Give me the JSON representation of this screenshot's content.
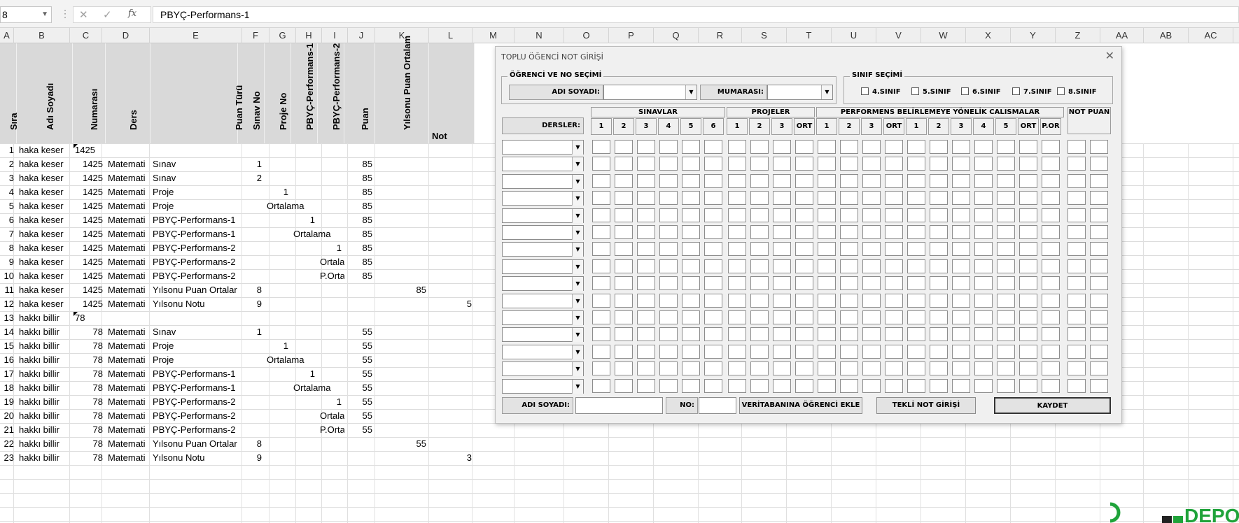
{
  "formula_bar": {
    "name_box": "8",
    "fx": "fx",
    "cancel": "✕",
    "enter": "✓",
    "content": "PBYÇ-Performans-1"
  },
  "columns": [
    "A",
    "B",
    "C",
    "D",
    "E",
    "F",
    "G",
    "H",
    "I",
    "J",
    "K",
    "L",
    "M",
    "N",
    "O",
    "P",
    "Q",
    "R",
    "S",
    "T",
    "U",
    "V",
    "W",
    "X",
    "Y",
    "Z",
    "AA",
    "AB",
    "AC"
  ],
  "header": {
    "sira": "Sıra",
    "adi_soyadi": "Adı Soyadı",
    "numarasi": "Numarası",
    "ders": "Ders",
    "puan_turu": "Puan Türü",
    "sinav_no": "Sınav No",
    "proje_no": "Proje No",
    "pbyc1": "PBYÇ-Performans-1",
    "pbyc2": "PBYÇ-Performans-2",
    "puan": "Puan",
    "yilsonu": "Yılsonu Puan Ortalam",
    "not": "Not"
  },
  "rows": [
    {
      "a": "1",
      "b": "haka keser",
      "c": "1425",
      "d": "",
      "e": "",
      "f": "",
      "g": "",
      "h": "",
      "i": "",
      "j": "",
      "k": "",
      "l": ""
    },
    {
      "a": "2",
      "b": "haka keser",
      "c": "1425",
      "d": "Matemati",
      "e": "Sınav",
      "f": "1",
      "g": "",
      "h": "",
      "i": "",
      "j": "85",
      "k": "",
      "l": ""
    },
    {
      "a": "3",
      "b": "haka keser",
      "c": "1425",
      "d": "Matemati",
      "e": "Sınav",
      "f": "2",
      "g": "",
      "h": "",
      "i": "",
      "j": "85",
      "k": "",
      "l": ""
    },
    {
      "a": "4",
      "b": "haka keser",
      "c": "1425",
      "d": "Matemati",
      "e": "Proje",
      "f": "",
      "g": "1",
      "h": "",
      "i": "",
      "j": "85",
      "k": "",
      "l": ""
    },
    {
      "a": "5",
      "b": "haka keser",
      "c": "1425",
      "d": "Matemati",
      "e": "Proje",
      "f": "",
      "g": "Ortalama",
      "h": "",
      "i": "",
      "j": "85",
      "k": "",
      "l": ""
    },
    {
      "a": "6",
      "b": "haka keser",
      "c": "1425",
      "d": "Matemati",
      "e": "PBYÇ-Performans-1",
      "f": "",
      "g": "",
      "h": "1",
      "i": "",
      "j": "85",
      "k": "",
      "l": ""
    },
    {
      "a": "7",
      "b": "haka keser",
      "c": "1425",
      "d": "Matemati",
      "e": "PBYÇ-Performans-1",
      "f": "",
      "g": "",
      "h": "Ortalama",
      "i": "",
      "j": "85",
      "k": "",
      "l": ""
    },
    {
      "a": "8",
      "b": "haka keser",
      "c": "1425",
      "d": "Matemati",
      "e": "PBYÇ-Performans-2",
      "f": "",
      "g": "",
      "h": "",
      "i": "1",
      "j": "85",
      "k": "",
      "l": ""
    },
    {
      "a": "9",
      "b": "haka keser",
      "c": "1425",
      "d": "Matemati",
      "e": "PBYÇ-Performans-2",
      "f": "",
      "g": "",
      "h": "",
      "i": "Ortala",
      "j": "85",
      "k": "",
      "l": ""
    },
    {
      "a": "10",
      "b": "haka keser",
      "c": "1425",
      "d": "Matemati",
      "e": "PBYÇ-Performans-2",
      "f": "",
      "g": "",
      "h": "",
      "i": "P.Orta",
      "j": "85",
      "k": "",
      "l": ""
    },
    {
      "a": "11",
      "b": "haka keser",
      "c": "1425",
      "d": "Matemati",
      "e": "Yılsonu Puan Ortalar",
      "f": "8",
      "g": "",
      "h": "",
      "i": "",
      "j": "",
      "k": "85",
      "l": ""
    },
    {
      "a": "12",
      "b": "haka keser",
      "c": "1425",
      "d": "Matemati",
      "e": "Yılsonu Notu",
      "f": "9",
      "g": "",
      "h": "",
      "i": "",
      "j": "",
      "k": "",
      "l": "5"
    },
    {
      "a": "13",
      "b": "hakkı billir",
      "c": "78",
      "d": "",
      "e": "",
      "f": "",
      "g": "",
      "h": "",
      "i": "",
      "j": "",
      "k": "",
      "l": ""
    },
    {
      "a": "14",
      "b": "hakkı billir",
      "c": "78",
      "d": "Matemati",
      "e": "Sınav",
      "f": "1",
      "g": "",
      "h": "",
      "i": "",
      "j": "55",
      "k": "",
      "l": ""
    },
    {
      "a": "15",
      "b": "hakkı billir",
      "c": "78",
      "d": "Matemati",
      "e": "Proje",
      "f": "",
      "g": "1",
      "h": "",
      "i": "",
      "j": "55",
      "k": "",
      "l": ""
    },
    {
      "a": "16",
      "b": "hakkı billir",
      "c": "78",
      "d": "Matemati",
      "e": "Proje",
      "f": "",
      "g": "Ortalama",
      "h": "",
      "i": "",
      "j": "55",
      "k": "",
      "l": ""
    },
    {
      "a": "17",
      "b": "hakkı billir",
      "c": "78",
      "d": "Matemati",
      "e": "PBYÇ-Performans-1",
      "f": "",
      "g": "",
      "h": "1",
      "i": "",
      "j": "55",
      "k": "",
      "l": ""
    },
    {
      "a": "18",
      "b": "hakkı billir",
      "c": "78",
      "d": "Matemati",
      "e": "PBYÇ-Performans-1",
      "f": "",
      "g": "",
      "h": "Ortalama",
      "i": "",
      "j": "55",
      "k": "",
      "l": ""
    },
    {
      "a": "19",
      "b": "hakkı billir",
      "c": "78",
      "d": "Matemati",
      "e": "PBYÇ-Performans-2",
      "f": "",
      "g": "",
      "h": "",
      "i": "1",
      "j": "55",
      "k": "",
      "l": ""
    },
    {
      "a": "20",
      "b": "hakkı billir",
      "c": "78",
      "d": "Matemati",
      "e": "PBYÇ-Performans-2",
      "f": "",
      "g": "",
      "h": "",
      "i": "Ortala",
      "j": "55",
      "k": "",
      "l": ""
    },
    {
      "a": "21",
      "b": "hakkı billir",
      "c": "78",
      "d": "Matemati",
      "e": "PBYÇ-Performans-2",
      "f": "",
      "g": "",
      "h": "",
      "i": "P.Orta",
      "j": "55",
      "k": "",
      "l": ""
    },
    {
      "a": "22",
      "b": "hakkı billir",
      "c": "78",
      "d": "Matemati",
      "e": "Yılsonu Puan Ortalar",
      "f": "8",
      "g": "",
      "h": "",
      "i": "",
      "j": "",
      "k": "55",
      "l": ""
    },
    {
      "a": "23",
      "b": "hakkı billir",
      "c": "78",
      "d": "Matemati",
      "e": "Yılsonu Notu",
      "f": "9",
      "g": "",
      "h": "",
      "i": "",
      "j": "",
      "k": "",
      "l": "3"
    }
  ],
  "form": {
    "title": "TOPLU ÖĞENCİ NOT GİRİŞİ",
    "close": "✕",
    "student_frame": "ÖĞRENCİ VE NO SEÇİMİ",
    "name_label": "ADI SOYADI:",
    "number_label": "MUMARASI:",
    "class_frame": "SINIF SEÇİMİ",
    "classes": [
      "4.SINIF",
      "5.SINIF",
      "6.SINIF",
      "7.SINIF",
      "8.SINIF"
    ],
    "groups": {
      "sinavlar": "SINAVLAR",
      "projeler": "PROJELER",
      "performans": "PERFORMENS BELİRLEMEYE YÖNELİK CALISMALAR",
      "not_puan": "NOT PUAN"
    },
    "dersler_label": "DERSLER:",
    "sub_headers": [
      "1",
      "2",
      "3",
      "4",
      "5",
      "6",
      "1",
      "2",
      "3",
      "ORT",
      "1",
      "2",
      "3",
      "ORT",
      "1",
      "2",
      "3",
      "4",
      "5",
      "ORT",
      "P.OR"
    ],
    "bottom": {
      "name_label": "ADI SOYADI:",
      "no_label": "NO:",
      "add_student": "VERİTABANINA ÖĞRENCİ EKLE",
      "single_entry": "TEKLİ NOT GİRİŞİ",
      "save": "KAYDET"
    }
  },
  "watermark": "DEPO"
}
